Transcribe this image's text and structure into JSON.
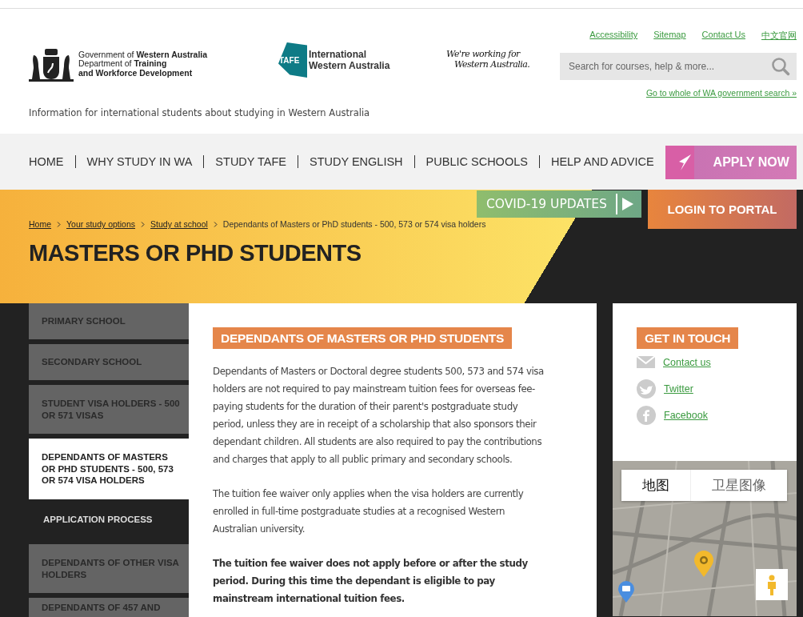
{
  "header": {
    "gov_logo": [
      "Government of **Western Australia**",
      "Department of **Training**",
      "**and Workforce Development**"
    ],
    "tafe_logo": {
      "badge": "TAFE",
      "lines": [
        "International",
        "Western Australia"
      ]
    },
    "slogan": [
      "We're working for",
      "Western Australia."
    ],
    "utility_links": [
      "Accessibility",
      "Sitemap",
      "Contact Us",
      "中文官网"
    ],
    "search": {
      "placeholder": "Search for courses, help & more..."
    },
    "gov_search_link": "Go to whole of WA government search »",
    "tagline": "Information for international students about studying in Western Australia"
  },
  "nav": {
    "items": [
      "HOME",
      "WHY STUDY IN WA",
      "STUDY TAFE",
      "STUDY ENGLISH",
      "PUBLIC SCHOOLS",
      "HELP AND ADVICE"
    ],
    "apply_button": "APPLY NOW"
  },
  "hero": {
    "covid_button": "COVID-19 UPDATES",
    "login_button": "LOGIN TO PORTAL",
    "breadcrumb": [
      {
        "label": "Home",
        "link": true
      },
      {
        "label": "Your study options",
        "link": true
      },
      {
        "label": "Study at school",
        "link": true
      },
      {
        "label": "Dependants of Masters or PhD students - 500, 573 or 574 visa holders",
        "link": false
      }
    ],
    "title": "MASTERS OR PHD STUDENTS"
  },
  "sidebar": {
    "items": [
      {
        "label": "PRIMARY SCHOOL",
        "kind": "item",
        "selected": false
      },
      {
        "label": "SECONDARY SCHOOL",
        "kind": "item",
        "selected": false
      },
      {
        "label": "STUDENT VISA HOLDERS - 500 OR 571 VISAS",
        "kind": "item",
        "selected": false
      },
      {
        "label": "DEPENDANTS OF MASTERS OR PHD STUDENTS - 500, 573 OR 574 VISA HOLDERS",
        "kind": "item",
        "selected": true
      },
      {
        "label": "APPLICATION PROCESS",
        "kind": "subitem",
        "selected": false
      },
      {
        "label": "DEPENDANTS OF OTHER VISA HOLDERS",
        "kind": "item",
        "selected": false
      },
      {
        "label": "DEPENDANTS OF 457 AND",
        "kind": "item",
        "selected": false
      }
    ]
  },
  "content": {
    "heading": "DEPENDANTS OF MASTERS OR PHD STUDENTS",
    "paragraphs": [
      {
        "text": "Dependants of Masters or Doctoral degree students 500, 573 and 574 visa holders are not required to pay mainstream tuition fees for overseas fee-paying students for the duration of their parent's postgraduate study period, unless they are in receipt of a scholarship that also sponsors their dependant children. All students are also required to pay the contributions and charges that apply to all public primary and secondary schools.",
        "bold": false
      },
      {
        "text": "The tuition fee waiver only applies when the visa holders are currently enrolled in full-time postgraduate studies at a recognised Western Australian university.",
        "bold": false
      },
      {
        "text": "The tuition fee waiver does not apply before or after the study period. During this time the dependant is eligible to pay mainstream international tuition fees.",
        "bold": true
      }
    ]
  },
  "contact": {
    "heading": "GET IN TOUCH",
    "links": [
      {
        "label": "Contact us",
        "kind": "email"
      },
      {
        "label": "Twitter",
        "kind": "twitter"
      },
      {
        "label": "Facebook",
        "kind": "facebook"
      }
    ]
  },
  "map": {
    "types": [
      {
        "label": "地图",
        "selected": true
      },
      {
        "label": "卫星图像",
        "selected": false
      }
    ]
  }
}
